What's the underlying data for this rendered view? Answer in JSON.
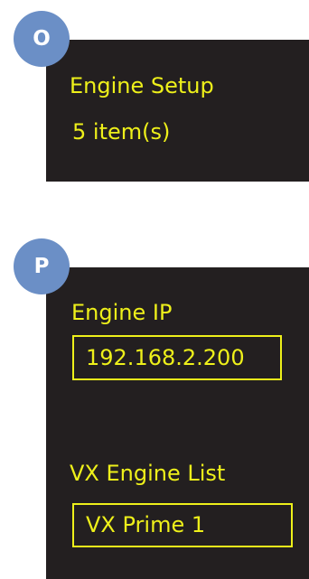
{
  "screen_o": {
    "badge": "O",
    "title": "Engine Setup",
    "item_count": "5 item(s)"
  },
  "screen_p": {
    "badge": "P",
    "engine_ip_label": "Engine IP",
    "engine_ip_value": "192.168.2.200",
    "engine_list_label": "VX Engine List",
    "engine_list_value": "VX Prime 1"
  },
  "colors": {
    "lcd_background": "#231f20",
    "lcd_text": "#eef01a",
    "badge": "#6b8fc6"
  }
}
